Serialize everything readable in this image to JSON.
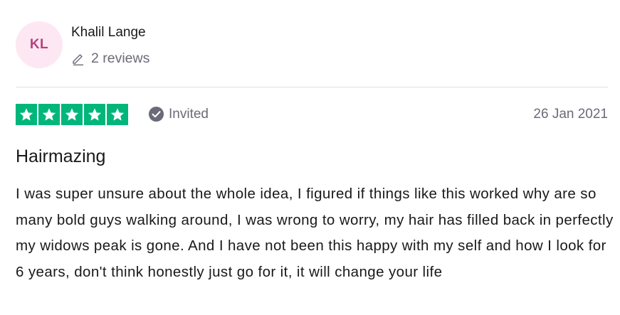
{
  "consumer": {
    "initials": "KL",
    "name": "Khalil Lange",
    "reviews_label": "2 reviews",
    "avatar_bg": "#fde7f2",
    "avatar_fg": "#b7407e"
  },
  "rating": {
    "stars": 5,
    "max_stars": 5,
    "star_color": "#00b67a",
    "verification_label": "Invited",
    "date": "26 Jan 2021"
  },
  "review": {
    "title": "Hairmazing",
    "text": "I was super unsure about the whole idea, I figured if things like this worked why are so many bold guys walking around, I was wrong to worry, my hair has filled back in perfectly my widows peak is gone. And I have not been this happy with my self and how I look for 6 years, don't think honestly just go for it, it will change your life"
  },
  "icons": [
    "pen-icon",
    "star-icon",
    "check-circle-icon"
  ]
}
